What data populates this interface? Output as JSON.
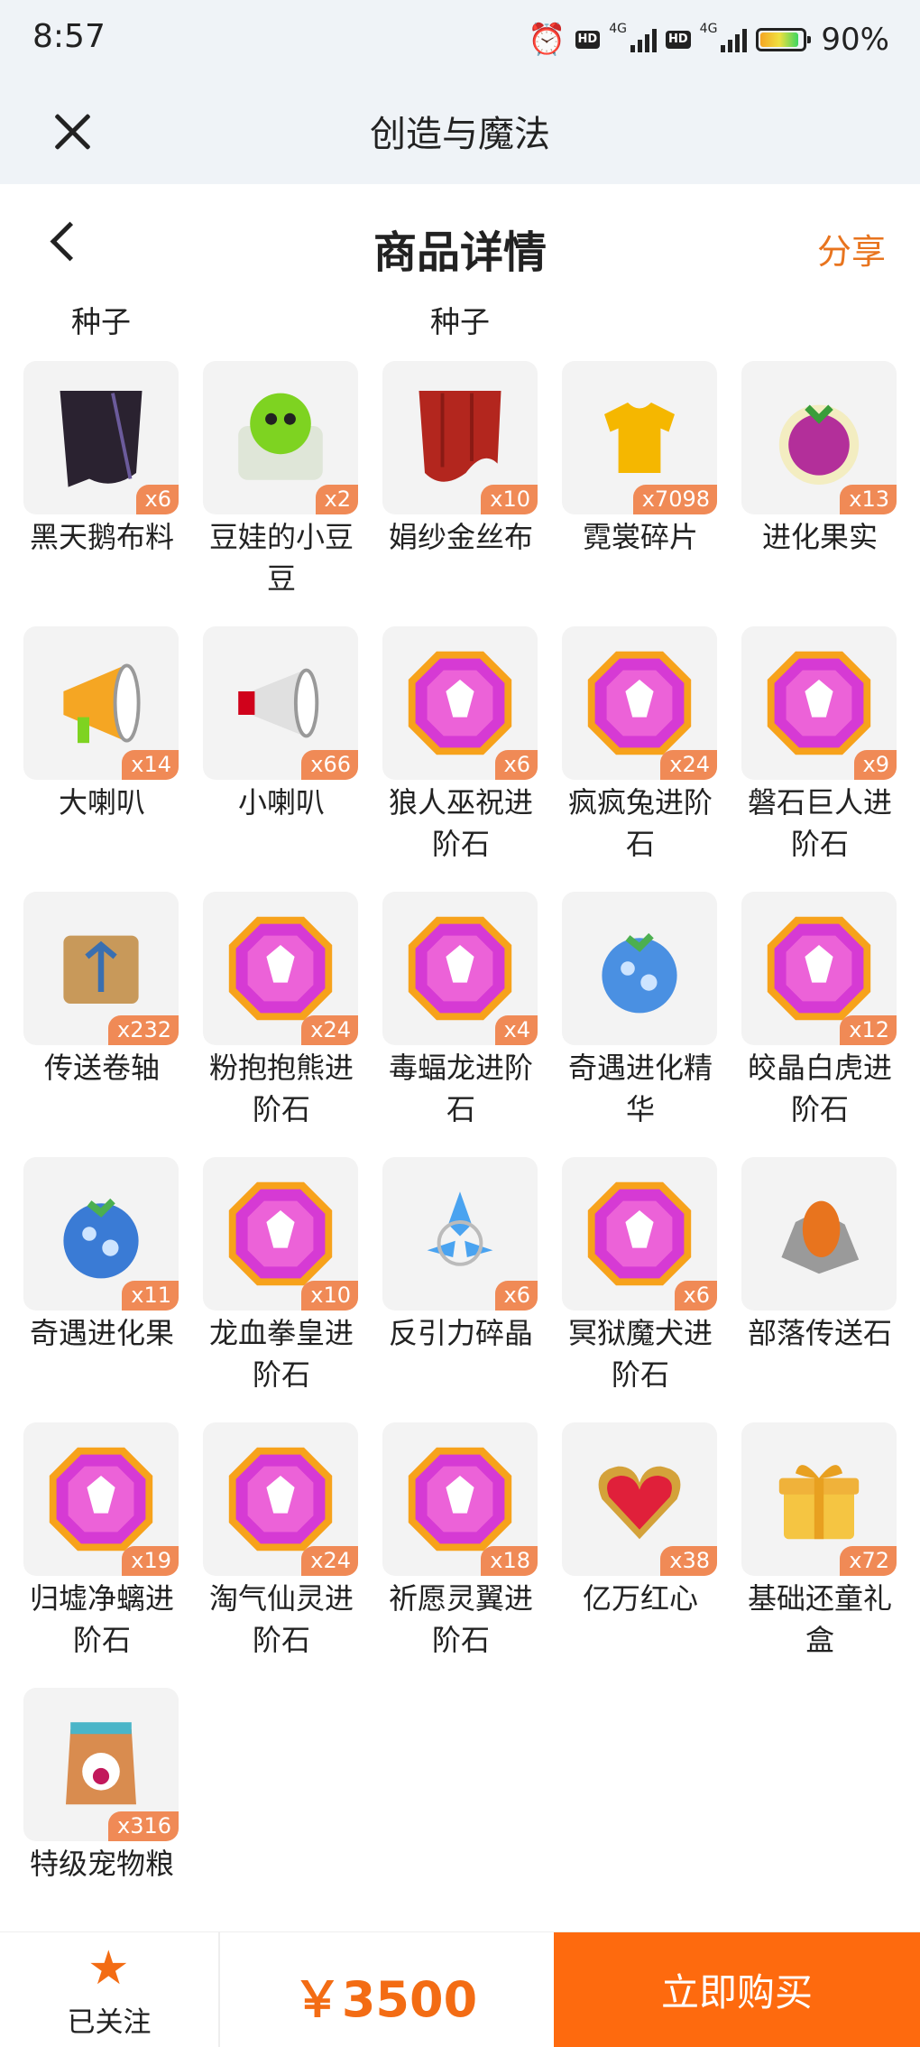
{
  "status_bar": {
    "time": "8:57",
    "network": "4G",
    "battery": "90%",
    "battery_level": 0.9
  },
  "app_bar": {
    "title": "创造与魔法"
  },
  "header": {
    "title": "商品详情",
    "share_label": "分享"
  },
  "previous_row_labels": [
    "种子",
    "种子"
  ],
  "items": [
    {
      "name": "黑天鹅布料",
      "count": "x6",
      "icon": "black-swan-cloth-icon",
      "color": "#2a2230"
    },
    {
      "name": "豆娃的小豆豆",
      "count": "x2",
      "icon": "bean-puzzle-icon",
      "color": "#7ed321"
    },
    {
      "name": "娟纱金丝布",
      "count": "x10",
      "icon": "red-silk-cloth-icon",
      "color": "#b3261e"
    },
    {
      "name": "霓裳碎片",
      "count": "x7098",
      "icon": "yellow-shirt-icon",
      "color": "#f5b700"
    },
    {
      "name": "进化果实",
      "count": "x13",
      "icon": "evolution-berry-icon",
      "color": "#b32f9a"
    },
    {
      "name": "大喇叭",
      "count": "x14",
      "icon": "big-megaphone-icon",
      "color": "#f5a623"
    },
    {
      "name": "小喇叭",
      "count": "x66",
      "icon": "small-megaphone-icon",
      "color": "#d0021b"
    },
    {
      "name": "狼人巫祝进阶石",
      "count": "x6",
      "icon": "gem-wolf-icon",
      "color": "#d63ad4"
    },
    {
      "name": "疯疯兔进阶石",
      "count": "x24",
      "icon": "gem-rabbit-icon",
      "color": "#d63ad4"
    },
    {
      "name": "磐石巨人进阶石",
      "count": "x9",
      "icon": "gem-giant-icon",
      "color": "#d63ad4"
    },
    {
      "name": "传送卷轴",
      "count": "x232",
      "icon": "teleport-scroll-icon",
      "color": "#c8995a"
    },
    {
      "name": "粉抱抱熊进阶石",
      "count": "x24",
      "icon": "gem-bear-icon",
      "color": "#d63ad4"
    },
    {
      "name": "毒蝠龙进阶石",
      "count": "x4",
      "icon": "gem-bat-dragon-icon",
      "color": "#d63ad4"
    },
    {
      "name": "奇遇进化精华",
      "count": "",
      "icon": "evolution-essence-icon",
      "color": "#4a90e2"
    },
    {
      "name": "皎晶白虎进阶石",
      "count": "x12",
      "icon": "gem-white-tiger-icon",
      "color": "#d63ad4"
    },
    {
      "name": "奇遇进化果",
      "count": "x11",
      "icon": "blue-evolution-fruit-icon",
      "color": "#3a7bd5"
    },
    {
      "name": "龙血拳皇进阶石",
      "count": "x10",
      "icon": "gem-dragon-fist-icon",
      "color": "#d63ad4"
    },
    {
      "name": "反引力碎晶",
      "count": "x6",
      "icon": "antigravity-crystal-icon",
      "color": "#4aa3f0"
    },
    {
      "name": "冥狱魔犬进阶石",
      "count": "x6",
      "icon": "gem-hell-hound-icon",
      "color": "#d63ad4"
    },
    {
      "name": "部落传送石",
      "count": "",
      "icon": "tribe-teleport-stone-icon",
      "color": "#e8741e"
    },
    {
      "name": "归墟净螭进阶石",
      "count": "x19",
      "icon": "gem-chi-dragon-icon",
      "color": "#d63ad4"
    },
    {
      "name": "淘气仙灵进阶石",
      "count": "x24",
      "icon": "gem-fairy-icon",
      "color": "#d63ad4"
    },
    {
      "name": "祈愿灵翼进阶石",
      "count": "x18",
      "icon": "gem-wing-icon",
      "color": "#d63ad4"
    },
    {
      "name": "亿万红心",
      "count": "x38",
      "icon": "red-heart-icon",
      "color": "#e0203a"
    },
    {
      "name": "基础还童礼盒",
      "count": "x72",
      "icon": "gift-box-icon",
      "color": "#f5c542"
    },
    {
      "name": "特级宠物粮",
      "count": "x316",
      "icon": "pet-food-bag-icon",
      "color": "#d98c4f"
    }
  ],
  "bottom_bar": {
    "follow_label": "已关注",
    "price": "￥3500",
    "buy_label": "立即购买"
  },
  "colors": {
    "accent": "#fe6a0e",
    "price": "#f36c14",
    "badge": "#f08a56"
  }
}
